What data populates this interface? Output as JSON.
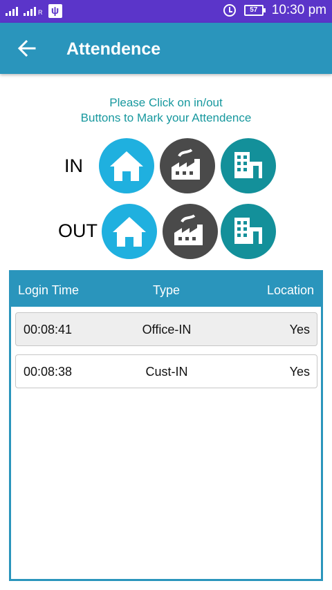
{
  "status_bar": {
    "signal_label_1": "",
    "signal_label_2": "R",
    "usb_icon": "usb-icon",
    "battery_level": "57",
    "time": "10:30 pm",
    "background": "#5b35c9"
  },
  "app_bar": {
    "title": "Attendence",
    "back_icon": "back-arrow-icon",
    "color": "#2a95bc"
  },
  "instructions": {
    "line1": "Please Click on in/out",
    "line2": "Buttons to Mark your Attendence",
    "color": "#17989e"
  },
  "in_row": {
    "label": "IN",
    "buttons": [
      "home-icon",
      "factory-icon",
      "office-building-icon"
    ]
  },
  "out_row": {
    "label": "OUT",
    "buttons": [
      "home-icon",
      "factory-icon",
      "office-building-icon"
    ]
  },
  "table": {
    "headers": [
      "Login Time",
      "Type",
      "Location"
    ],
    "rows": [
      {
        "time": "00:08:41",
        "type": "Office-IN",
        "location": "Yes"
      },
      {
        "time": "00:08:38",
        "type": "Cust-IN",
        "location": "Yes"
      }
    ]
  }
}
